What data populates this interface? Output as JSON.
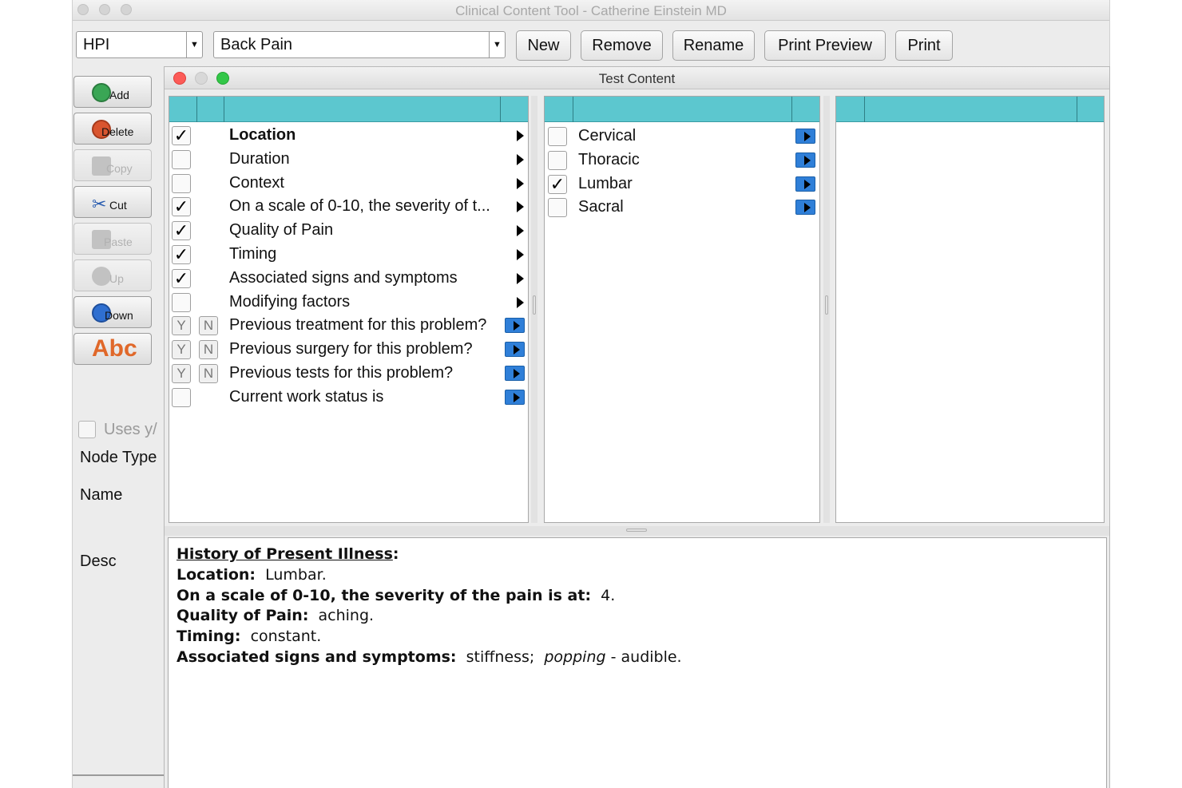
{
  "window": {
    "title": "Clinical Content Tool - Catherine Einstein MD"
  },
  "toolbar": {
    "section_value": "HPI",
    "template_value": "Back Pain",
    "new_label": "New",
    "remove_label": "Remove",
    "rename_label": "Rename",
    "print_preview_label": "Print Preview",
    "print_label": "Print"
  },
  "sidebar": {
    "add_label": "Add",
    "delete_label": "Delete",
    "copy_label": "Copy",
    "cut_label": "Cut",
    "paste_label": "Paste",
    "up_label": "Up",
    "down_label": "Down",
    "spell_label": "Abc",
    "uses_label": "Uses y/",
    "node_type_label": "Node Type",
    "name_label": "Name",
    "desc_label": "Desc"
  },
  "dialog": {
    "title": "Test Content",
    "left_items": [
      {
        "label": "Location",
        "checked": true,
        "bold": true,
        "kind": "check",
        "end": "arrow"
      },
      {
        "label": "Duration",
        "checked": false,
        "kind": "check",
        "end": "arrow"
      },
      {
        "label": "Context",
        "checked": false,
        "kind": "check",
        "end": "arrow"
      },
      {
        "label": "On a scale of 0-10, the severity of t...",
        "checked": true,
        "kind": "check",
        "end": "arrow"
      },
      {
        "label": "Quality of Pain",
        "checked": true,
        "kind": "check",
        "end": "arrow"
      },
      {
        "label": "Timing",
        "checked": true,
        "kind": "check",
        "end": "arrow"
      },
      {
        "label": "Associated signs and symptoms",
        "checked": true,
        "kind": "check",
        "end": "arrow"
      },
      {
        "label": "Modifying factors",
        "checked": false,
        "kind": "check",
        "end": "arrow"
      },
      {
        "label": "Previous treatment for this problem?",
        "kind": "yn",
        "end": "nav"
      },
      {
        "label": "Previous surgery for this problem?",
        "kind": "yn",
        "end": "nav"
      },
      {
        "label": "Previous tests for this problem?",
        "kind": "yn",
        "end": "nav"
      },
      {
        "label": "Current work status is",
        "checked": false,
        "kind": "check",
        "end": "nav"
      }
    ],
    "yes_label": "Y",
    "no_label": "N",
    "middle_items": [
      {
        "label": "Cervical",
        "checked": false
      },
      {
        "label": "Thoracic",
        "checked": false
      },
      {
        "label": "Lumbar",
        "checked": true
      },
      {
        "label": "Sacral",
        "checked": false
      }
    ]
  },
  "note": {
    "heading": "History of Present Illness",
    "lines": [
      {
        "label": "Location:",
        "value": "Lumbar."
      },
      {
        "label": "On a scale of 0-10, the severity of the pain is at:",
        "value": "4."
      },
      {
        "label": "Quality of Pain:",
        "value": "aching."
      },
      {
        "label": "Timing:",
        "value": "constant."
      }
    ],
    "assoc_label": "Associated signs and symptoms:",
    "assoc_value1": "stiffness;",
    "assoc_value2_italic": "popping",
    "assoc_value3": "- audible."
  },
  "colors": {
    "grid_header": "#5cc7cf",
    "nav_icon": "#2f7fd8"
  }
}
